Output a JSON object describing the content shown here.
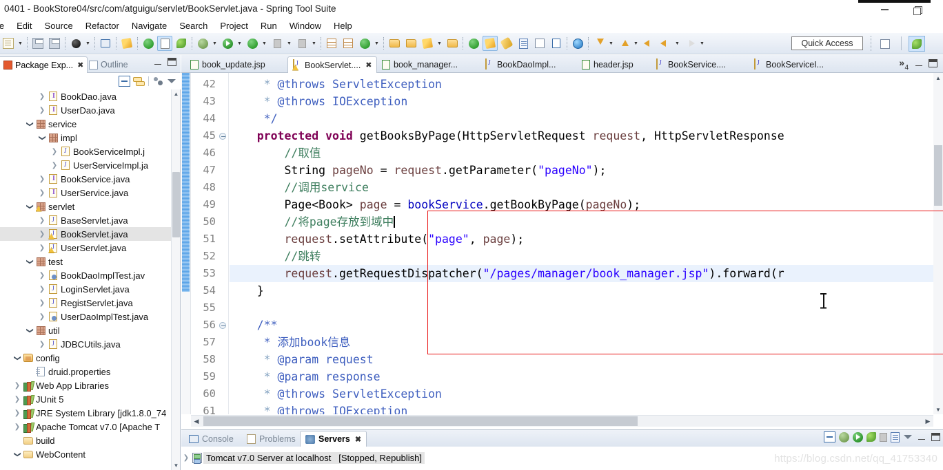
{
  "window": {
    "title": "0401 - BookStore04/src/com/atguigu/servlet/BookServlet.java - Spring Tool Suite",
    "minimize_label": "Minimize",
    "restore_label": "Restore"
  },
  "menubar": {
    "items": [
      "le",
      "Edit",
      "Source",
      "Refactor",
      "Navigate",
      "Search",
      "Project",
      "Run",
      "Window",
      "Help"
    ]
  },
  "toolbar": {
    "quick_access": "Quick Access",
    "icons": [
      "new-file-icon",
      "new-file-dropdown-icon",
      "save-icon",
      "save-all-icon",
      "user-icon",
      "user-dropdown-icon",
      "console-icon",
      "link-icon",
      "spring-boot-icon",
      "ruler-icon",
      "leaf-icon",
      "debug-icon",
      "debug-dropdown-icon",
      "run-icon",
      "run-dropdown-icon",
      "run-as-server-icon",
      "run-as-dropdown-icon",
      "stop-icon",
      "stop-dropdown-icon",
      "profile-icon",
      "profile-dropdown-icon",
      "new-java-project-icon",
      "new-package-icon",
      "new-class-icon",
      "new-class-dropdown-icon",
      "open-type-icon",
      "open-resource-icon",
      "edit-icon",
      "edit-dropdown-icon",
      "open-task-icon",
      "tag-icon",
      "highlight-icon",
      "mark-icon",
      "export-icon",
      "table-icon",
      "paragraph-icon",
      "globe-icon",
      "next-annotation-icon",
      "next-annotation-dropdown-icon",
      "prev-annotation-icon",
      "prev-annotation-dropdown-icon",
      "back-icon",
      "back-history-icon",
      "back-dropdown-icon",
      "forward-icon",
      "forward-dropdown-icon"
    ],
    "perspective_icons": [
      "open-perspective-icon",
      "spring-perspective-icon"
    ]
  },
  "left_panel": {
    "tabs": [
      {
        "label": "Package Exp...",
        "icon": "package-explorer-icon",
        "active": true,
        "closable": true
      },
      {
        "label": "Outline",
        "icon": "outline-icon",
        "active": false,
        "closable": false
      }
    ],
    "toolbar_icons": [
      "collapse-all-icon",
      "link-with-editor-icon",
      "view-menu-dots-icon",
      "view-menu-icon"
    ],
    "minimize_label": "Minimize",
    "maximize_label": "Maximize",
    "tree": [
      {
        "label": "BookDao.java",
        "icon": "java-interface-icon",
        "indent": 3,
        "arrow": "closed"
      },
      {
        "label": "UserDao.java",
        "icon": "java-interface-icon",
        "indent": 3,
        "arrow": "closed"
      },
      {
        "label": "service",
        "icon": "package-icon",
        "indent": 2,
        "arrow": "open"
      },
      {
        "label": "impl",
        "icon": "package-icon",
        "indent": 3,
        "arrow": "open"
      },
      {
        "label": "BookServiceImpl.j",
        "icon": "java-class-icon",
        "indent": 4,
        "arrow": "closed"
      },
      {
        "label": "UserServiceImpl.ja",
        "icon": "java-class-icon",
        "indent": 4,
        "arrow": "closed"
      },
      {
        "label": "BookService.java",
        "icon": "java-interface-icon",
        "indent": 3,
        "arrow": "closed"
      },
      {
        "label": "UserService.java",
        "icon": "java-interface-icon",
        "indent": 3,
        "arrow": "closed"
      },
      {
        "label": "servlet",
        "icon": "package-warning-icon",
        "indent": 2,
        "arrow": "open"
      },
      {
        "label": "BaseServlet.java",
        "icon": "java-class-icon",
        "indent": 3,
        "arrow": "closed"
      },
      {
        "label": "BookServlet.java",
        "icon": "java-class-warning-icon",
        "indent": 3,
        "arrow": "closed",
        "selected": true
      },
      {
        "label": "UserServlet.java",
        "icon": "java-class-warning-icon",
        "indent": 3,
        "arrow": "closed"
      },
      {
        "label": "test",
        "icon": "package-icon",
        "indent": 2,
        "arrow": "open"
      },
      {
        "label": "BookDaoImplTest.jav",
        "icon": "java-test-icon",
        "indent": 3,
        "arrow": "closed"
      },
      {
        "label": "LoginServlet.java",
        "icon": "java-class-icon",
        "indent": 3,
        "arrow": "closed"
      },
      {
        "label": "RegistServlet.java",
        "icon": "java-class-icon",
        "indent": 3,
        "arrow": "closed"
      },
      {
        "label": "UserDaoImplTest.java",
        "icon": "java-test-icon",
        "indent": 3,
        "arrow": "closed"
      },
      {
        "label": "util",
        "icon": "package-icon",
        "indent": 2,
        "arrow": "open"
      },
      {
        "label": "JDBCUtils.java",
        "icon": "java-class-icon",
        "indent": 3,
        "arrow": "closed"
      },
      {
        "label": "config",
        "icon": "source-folder-icon",
        "indent": 1,
        "arrow": "open"
      },
      {
        "label": "druid.properties",
        "icon": "properties-file-icon",
        "indent": 2,
        "arrow": "none"
      },
      {
        "label": "Web App Libraries",
        "icon": "library-icon",
        "indent": 1,
        "arrow": "closed"
      },
      {
        "label": "JUnit 5",
        "icon": "library-icon",
        "indent": 1,
        "arrow": "closed"
      },
      {
        "label": "JRE System Library [jdk1.8.0_74",
        "icon": "library-icon",
        "indent": 1,
        "arrow": "closed"
      },
      {
        "label": "Apache Tomcat v7.0 [Apache T",
        "icon": "library-icon",
        "indent": 1,
        "arrow": "closed"
      },
      {
        "label": "build",
        "icon": "folder-icon",
        "indent": 1,
        "arrow": "none"
      },
      {
        "label": "WebContent",
        "icon": "folder-icon",
        "indent": 1,
        "arrow": "open"
      }
    ]
  },
  "editor": {
    "tabs": [
      {
        "label": "book_update.jsp",
        "icon": "jsp-file-icon",
        "active": false,
        "closable": false
      },
      {
        "label": "BookServlet....",
        "icon": "java-class-warning-icon",
        "active": true,
        "closable": true
      },
      {
        "label": "book_manager...",
        "icon": "jsp-file-icon",
        "active": false,
        "closable": false
      },
      {
        "label": "BookDaoImpl...",
        "icon": "java-class-icon",
        "active": false,
        "closable": false
      },
      {
        "label": "header.jsp",
        "icon": "jsp-file-icon",
        "active": false,
        "closable": false
      },
      {
        "label": "BookService....",
        "icon": "java-class-icon",
        "active": false,
        "closable": false
      },
      {
        "label": "BookServiceI...",
        "icon": "java-class-icon",
        "active": false,
        "closable": false
      }
    ],
    "overflow_indicator": "»",
    "overflow_count": "4",
    "minimize_label": "Minimize",
    "maximize_label": "Maximize",
    "lines": [
      {
        "n": "42",
        "fold": false,
        "hl": false
      },
      {
        "n": "43",
        "fold": false,
        "hl": false
      },
      {
        "n": "44",
        "fold": false,
        "hl": false
      },
      {
        "n": "45",
        "fold": true,
        "hl": false
      },
      {
        "n": "46",
        "fold": false,
        "hl": false
      },
      {
        "n": "47",
        "fold": false,
        "hl": false
      },
      {
        "n": "48",
        "fold": false,
        "hl": false
      },
      {
        "n": "49",
        "fold": false,
        "hl": false
      },
      {
        "n": "50",
        "fold": false,
        "hl": false
      },
      {
        "n": "51",
        "fold": false,
        "hl": false
      },
      {
        "n": "52",
        "fold": false,
        "hl": false
      },
      {
        "n": "53",
        "fold": false,
        "hl": true
      },
      {
        "n": "54",
        "fold": false,
        "hl": false
      },
      {
        "n": "55",
        "fold": false,
        "hl": false
      },
      {
        "n": "56",
        "fold": true,
        "hl": false
      },
      {
        "n": "57",
        "fold": false,
        "hl": false
      },
      {
        "n": "58",
        "fold": false,
        "hl": false
      },
      {
        "n": "59",
        "fold": false,
        "hl": false
      },
      {
        "n": "60",
        "fold": false,
        "hl": false
      },
      {
        "n": "61",
        "fold": false,
        "hl": false
      }
    ],
    "code_text": [
      "     * @throws ServletException",
      "     * @throws IOException",
      "     */",
      "    protected void getBooksByPage(HttpServletRequest request, HttpServletResponse",
      "        //取值",
      "        String pageNo = request.getParameter(\"pageNo\");",
      "        //调用service",
      "        Page<Book> page = bookService.getBookByPage(pageNo);",
      "        //将page存放到域中",
      "        request.setAttribute(\"page\", page);",
      "        //跳转",
      "        request.getRequestDispatcher(\"/pages/manager/book_manager.jsp\").forward(r",
      "    }",
      "",
      "    /**",
      "     * 添加book信息",
      "     * @param request",
      "     * @param response",
      "     * @throws ServletException",
      "     * @throws IOException"
    ],
    "annotation_box_color": "#e81313"
  },
  "bottom_panel": {
    "tabs": [
      {
        "label": "Console",
        "icon": "console-icon",
        "active": false
      },
      {
        "label": "Problems",
        "icon": "problems-icon",
        "active": false
      },
      {
        "label": "Servers",
        "icon": "servers-icon",
        "active": true,
        "closable": true
      }
    ],
    "toolbar_icons": [
      "new-server-icon",
      "debug-server-icon",
      "start-server-icon",
      "profile-server-icon",
      "stop-server-icon",
      "publish-icon",
      "view-menu-icon",
      "minimize-icon",
      "maximize-icon"
    ],
    "server": {
      "name": "Tomcat v7.0 Server at localhost",
      "status": "[Stopped, Republish]",
      "icon": "server-icon",
      "arrow": "closed"
    }
  },
  "watermark": "https://blog.csdn.net/qq_41753340"
}
